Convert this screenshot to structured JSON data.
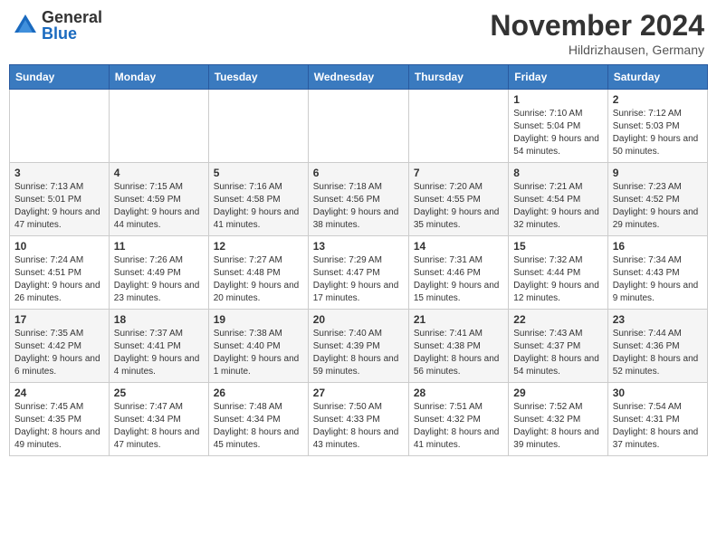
{
  "logo": {
    "general": "General",
    "blue": "Blue"
  },
  "title": "November 2024",
  "location": "Hildrizhausen, Germany",
  "weekdays": [
    "Sunday",
    "Monday",
    "Tuesday",
    "Wednesday",
    "Thursday",
    "Friday",
    "Saturday"
  ],
  "weeks": [
    [
      {
        "day": "",
        "info": ""
      },
      {
        "day": "",
        "info": ""
      },
      {
        "day": "",
        "info": ""
      },
      {
        "day": "",
        "info": ""
      },
      {
        "day": "",
        "info": ""
      },
      {
        "day": "1",
        "info": "Sunrise: 7:10 AM\nSunset: 5:04 PM\nDaylight: 9 hours and 54 minutes."
      },
      {
        "day": "2",
        "info": "Sunrise: 7:12 AM\nSunset: 5:03 PM\nDaylight: 9 hours and 50 minutes."
      }
    ],
    [
      {
        "day": "3",
        "info": "Sunrise: 7:13 AM\nSunset: 5:01 PM\nDaylight: 9 hours and 47 minutes."
      },
      {
        "day": "4",
        "info": "Sunrise: 7:15 AM\nSunset: 4:59 PM\nDaylight: 9 hours and 44 minutes."
      },
      {
        "day": "5",
        "info": "Sunrise: 7:16 AM\nSunset: 4:58 PM\nDaylight: 9 hours and 41 minutes."
      },
      {
        "day": "6",
        "info": "Sunrise: 7:18 AM\nSunset: 4:56 PM\nDaylight: 9 hours and 38 minutes."
      },
      {
        "day": "7",
        "info": "Sunrise: 7:20 AM\nSunset: 4:55 PM\nDaylight: 9 hours and 35 minutes."
      },
      {
        "day": "8",
        "info": "Sunrise: 7:21 AM\nSunset: 4:54 PM\nDaylight: 9 hours and 32 minutes."
      },
      {
        "day": "9",
        "info": "Sunrise: 7:23 AM\nSunset: 4:52 PM\nDaylight: 9 hours and 29 minutes."
      }
    ],
    [
      {
        "day": "10",
        "info": "Sunrise: 7:24 AM\nSunset: 4:51 PM\nDaylight: 9 hours and 26 minutes."
      },
      {
        "day": "11",
        "info": "Sunrise: 7:26 AM\nSunset: 4:49 PM\nDaylight: 9 hours and 23 minutes."
      },
      {
        "day": "12",
        "info": "Sunrise: 7:27 AM\nSunset: 4:48 PM\nDaylight: 9 hours and 20 minutes."
      },
      {
        "day": "13",
        "info": "Sunrise: 7:29 AM\nSunset: 4:47 PM\nDaylight: 9 hours and 17 minutes."
      },
      {
        "day": "14",
        "info": "Sunrise: 7:31 AM\nSunset: 4:46 PM\nDaylight: 9 hours and 15 minutes."
      },
      {
        "day": "15",
        "info": "Sunrise: 7:32 AM\nSunset: 4:44 PM\nDaylight: 9 hours and 12 minutes."
      },
      {
        "day": "16",
        "info": "Sunrise: 7:34 AM\nSunset: 4:43 PM\nDaylight: 9 hours and 9 minutes."
      }
    ],
    [
      {
        "day": "17",
        "info": "Sunrise: 7:35 AM\nSunset: 4:42 PM\nDaylight: 9 hours and 6 minutes."
      },
      {
        "day": "18",
        "info": "Sunrise: 7:37 AM\nSunset: 4:41 PM\nDaylight: 9 hours and 4 minutes."
      },
      {
        "day": "19",
        "info": "Sunrise: 7:38 AM\nSunset: 4:40 PM\nDaylight: 9 hours and 1 minute."
      },
      {
        "day": "20",
        "info": "Sunrise: 7:40 AM\nSunset: 4:39 PM\nDaylight: 8 hours and 59 minutes."
      },
      {
        "day": "21",
        "info": "Sunrise: 7:41 AM\nSunset: 4:38 PM\nDaylight: 8 hours and 56 minutes."
      },
      {
        "day": "22",
        "info": "Sunrise: 7:43 AM\nSunset: 4:37 PM\nDaylight: 8 hours and 54 minutes."
      },
      {
        "day": "23",
        "info": "Sunrise: 7:44 AM\nSunset: 4:36 PM\nDaylight: 8 hours and 52 minutes."
      }
    ],
    [
      {
        "day": "24",
        "info": "Sunrise: 7:45 AM\nSunset: 4:35 PM\nDaylight: 8 hours and 49 minutes."
      },
      {
        "day": "25",
        "info": "Sunrise: 7:47 AM\nSunset: 4:34 PM\nDaylight: 8 hours and 47 minutes."
      },
      {
        "day": "26",
        "info": "Sunrise: 7:48 AM\nSunset: 4:34 PM\nDaylight: 8 hours and 45 minutes."
      },
      {
        "day": "27",
        "info": "Sunrise: 7:50 AM\nSunset: 4:33 PM\nDaylight: 8 hours and 43 minutes."
      },
      {
        "day": "28",
        "info": "Sunrise: 7:51 AM\nSunset: 4:32 PM\nDaylight: 8 hours and 41 minutes."
      },
      {
        "day": "29",
        "info": "Sunrise: 7:52 AM\nSunset: 4:32 PM\nDaylight: 8 hours and 39 minutes."
      },
      {
        "day": "30",
        "info": "Sunrise: 7:54 AM\nSunset: 4:31 PM\nDaylight: 8 hours and 37 minutes."
      }
    ]
  ]
}
